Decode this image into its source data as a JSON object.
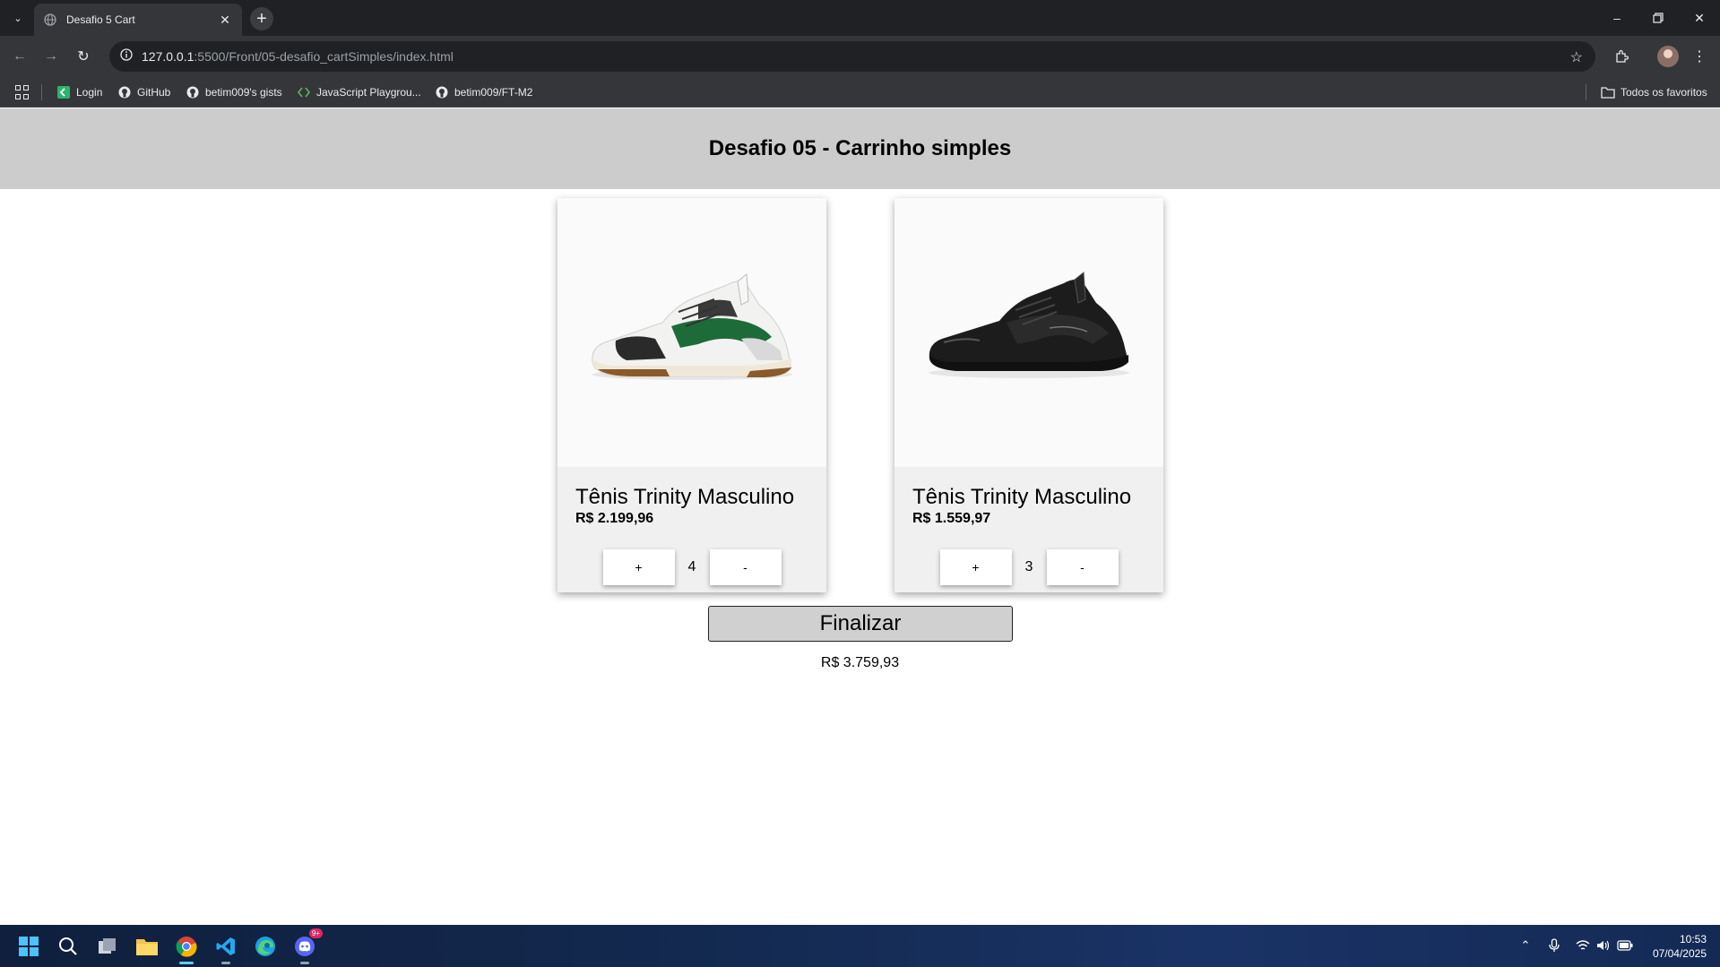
{
  "browser": {
    "tab_title": "Desafio 5 Cart",
    "new_tab_symbol": "+",
    "url_host": "127.0.0.1",
    "url_path": ":5500/Front/05-desafio_cartSimples/index.html",
    "bookmarks": [
      {
        "label": "Login",
        "icon": "login-icon"
      },
      {
        "label": "GitHub",
        "icon": "github-icon"
      },
      {
        "label": "betim009's gists",
        "icon": "github-icon"
      },
      {
        "label": "JavaScript Playgrou...",
        "icon": "playground-icon"
      },
      {
        "label": "betim009/FT-M2",
        "icon": "github-icon"
      }
    ],
    "all_bookmarks": "Todos os favoritos",
    "colors": {
      "tabbar": "#202124",
      "toolbar": "#35363a"
    }
  },
  "page": {
    "title": "Desafio 05 - Carrinho simples",
    "products": [
      {
        "name": "Tênis Trinity Masculino",
        "price": "R$ 2.199,96",
        "quantity": "4",
        "image": "white-green-sneaker"
      },
      {
        "name": "Tênis Trinity Masculino",
        "price": "R$ 1.559,97",
        "quantity": "3",
        "image": "black-sneaker"
      }
    ],
    "plus_label": "+",
    "minus_label": "-",
    "finalize_label": "Finalizar",
    "total": "R$ 3.759,93",
    "colors": {
      "header": "#cccccc",
      "card": "#f0f0f0",
      "button": "#d0d0d0"
    }
  },
  "taskbar": {
    "time": "10:53",
    "date": "07/04/2025",
    "discord_badge": "9+"
  }
}
